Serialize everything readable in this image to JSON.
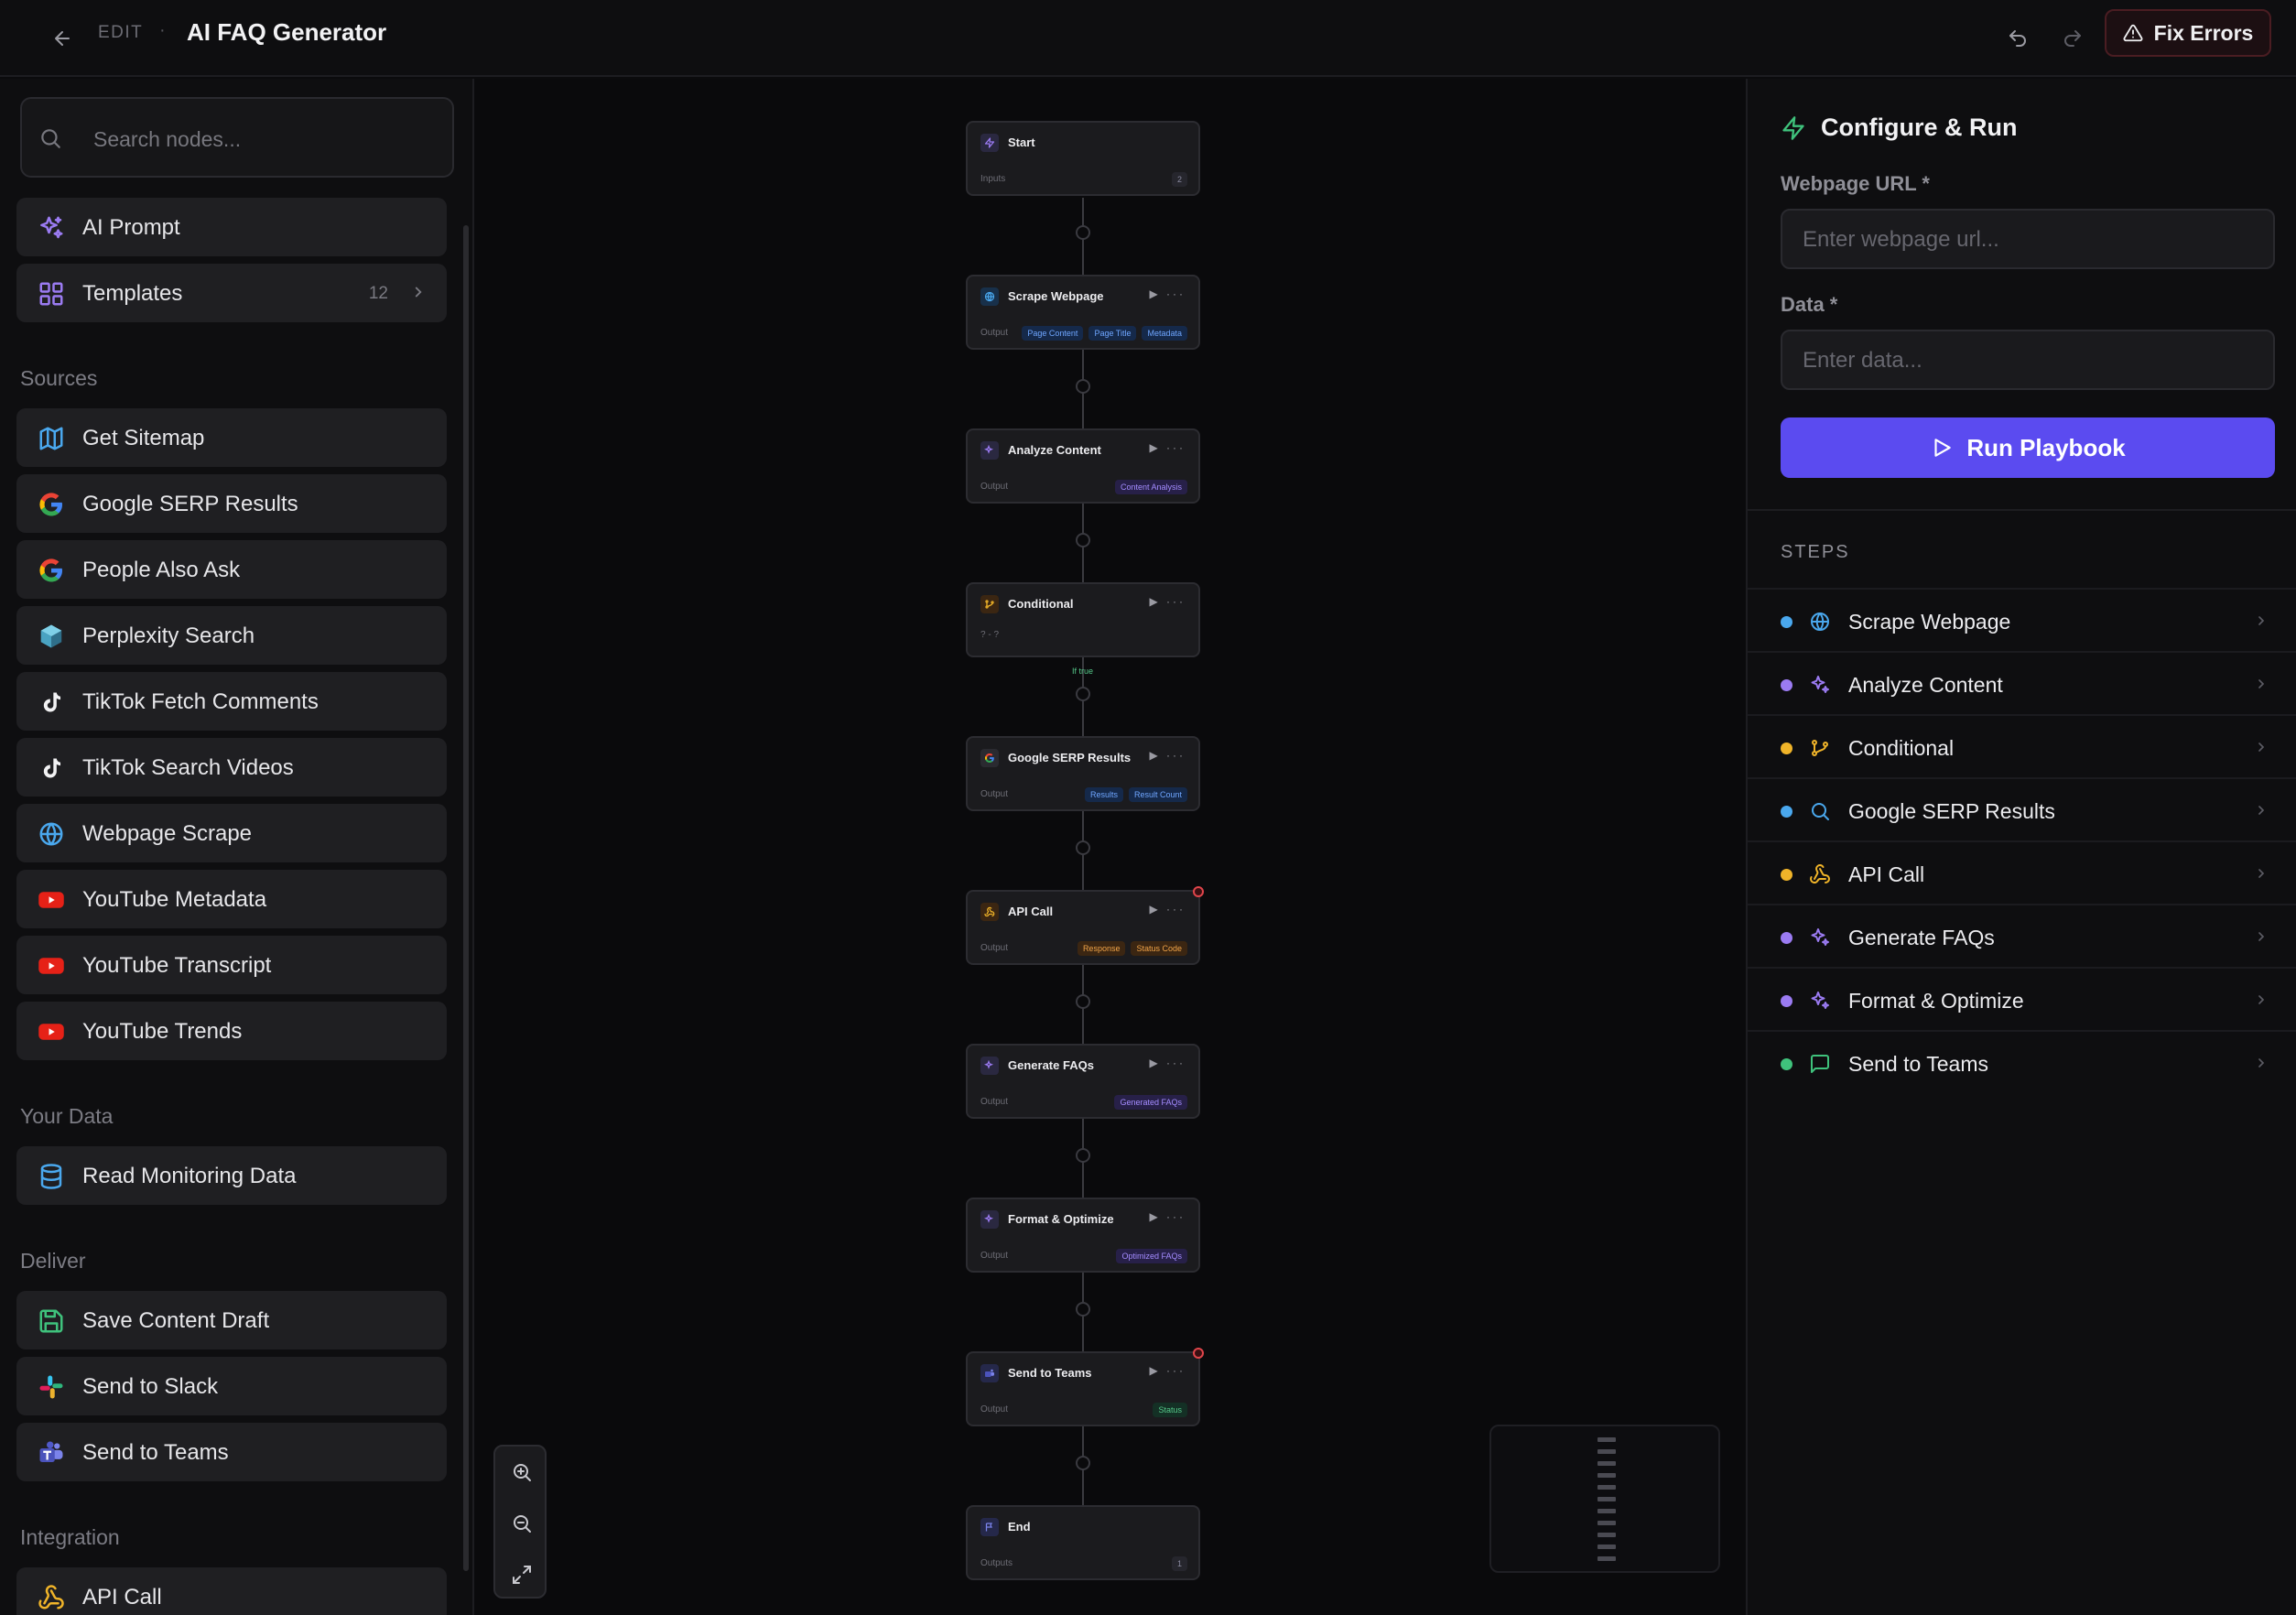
{
  "header": {
    "edit_label": "EDIT",
    "separator": "·",
    "title": "AI FAQ Generator",
    "fix_errors_label": "Fix Errors"
  },
  "sidebar": {
    "search_placeholder": "Search nodes...",
    "top_items": [
      {
        "label": "AI Prompt",
        "icon": "sparkles-icon"
      },
      {
        "label": "Templates",
        "icon": "grid-icon",
        "count": "12"
      }
    ],
    "sections": {
      "sources": {
        "title": "Sources",
        "items": [
          {
            "label": "Get Sitemap",
            "icon": "map-icon"
          },
          {
            "label": "Google SERP Results",
            "icon": "google-icon"
          },
          {
            "label": "People Also Ask",
            "icon": "google-icon"
          },
          {
            "label": "Perplexity Search",
            "icon": "perplexity-icon"
          },
          {
            "label": "TikTok Fetch Comments",
            "icon": "tiktok-icon"
          },
          {
            "label": "TikTok Search Videos",
            "icon": "tiktok-icon"
          },
          {
            "label": "Webpage Scrape",
            "icon": "globe-icon"
          },
          {
            "label": "YouTube Metadata",
            "icon": "youtube-icon"
          },
          {
            "label": "YouTube Transcript",
            "icon": "youtube-icon"
          },
          {
            "label": "YouTube Trends",
            "icon": "youtube-icon"
          }
        ]
      },
      "your_data": {
        "title": "Your Data",
        "items": [
          {
            "label": "Read Monitoring Data",
            "icon": "database-icon"
          }
        ]
      },
      "deliver": {
        "title": "Deliver",
        "items": [
          {
            "label": "Save Content Draft",
            "icon": "save-icon"
          },
          {
            "label": "Send to Slack",
            "icon": "slack-icon"
          },
          {
            "label": "Send to Teams",
            "icon": "teams-icon"
          }
        ]
      },
      "integration": {
        "title": "Integration",
        "items": [
          {
            "label": "API Call",
            "icon": "webhook-icon"
          }
        ]
      }
    }
  },
  "canvas": {
    "nodes": [
      {
        "name": "Start",
        "label": "Inputs",
        "badge": "2",
        "icon": "zap-icon"
      },
      {
        "name": "Scrape Webpage",
        "label": "Output",
        "tags": [
          "Page Content",
          "Page Title",
          "Metadata"
        ],
        "icon": "globe-icon"
      },
      {
        "name": "Analyze Content",
        "label": "Output",
        "tags": [
          "Content Analysis"
        ],
        "icon": "sparkles-icon"
      },
      {
        "name": "Conditional",
        "label": "? - ?",
        "icon": "branch-icon"
      },
      {
        "name": "Google SERP Results",
        "label": "Output",
        "tags": [
          "Results",
          "Result Count"
        ],
        "icon": "google-icon"
      },
      {
        "name": "API Call",
        "label": "Output",
        "tags": [
          "Response",
          "Status Code"
        ],
        "icon": "webhook-icon"
      },
      {
        "name": "Generate FAQs",
        "label": "Output",
        "tags": [
          "Generated FAQs"
        ],
        "icon": "sparkles-icon"
      },
      {
        "name": "Format & Optimize",
        "label": "Output",
        "tags": [
          "Optimized FAQs"
        ],
        "icon": "sparkles-icon"
      },
      {
        "name": "Send to Teams",
        "label": "Output",
        "tags": [
          "Status"
        ],
        "icon": "teams-icon"
      },
      {
        "name": "End",
        "label": "Outputs",
        "badge": "1",
        "icon": "flag-icon"
      }
    ],
    "branch_label": "If true"
  },
  "config": {
    "title": "Configure & Run",
    "url_label": "Webpage URL *",
    "url_placeholder": "Enter webpage url...",
    "data_label": "Data *",
    "data_placeholder": "Enter data...",
    "run_label": "Run Playbook",
    "steps_title": "STEPS",
    "steps": [
      {
        "label": "Scrape Webpage",
        "color": "#4aa8ee",
        "icon": "globe-icon"
      },
      {
        "label": "Analyze Content",
        "color": "#9b7bf2",
        "icon": "sparkles-icon"
      },
      {
        "label": "Conditional",
        "color": "#f0b429",
        "icon": "branch-icon"
      },
      {
        "label": "Google SERP Results",
        "color": "#4aa8ee",
        "icon": "search-icon"
      },
      {
        "label": "API Call",
        "color": "#f0b429",
        "icon": "webhook-icon"
      },
      {
        "label": "Generate FAQs",
        "color": "#9b7bf2",
        "icon": "sparkles-icon"
      },
      {
        "label": "Format & Optimize",
        "color": "#9b7bf2",
        "icon": "sparkles-icon"
      },
      {
        "label": "Send to Teams",
        "color": "#3fc27c",
        "icon": "message-icon"
      }
    ]
  },
  "colors": {
    "accent": "#5b4bf0",
    "error": "#e0454b"
  }
}
